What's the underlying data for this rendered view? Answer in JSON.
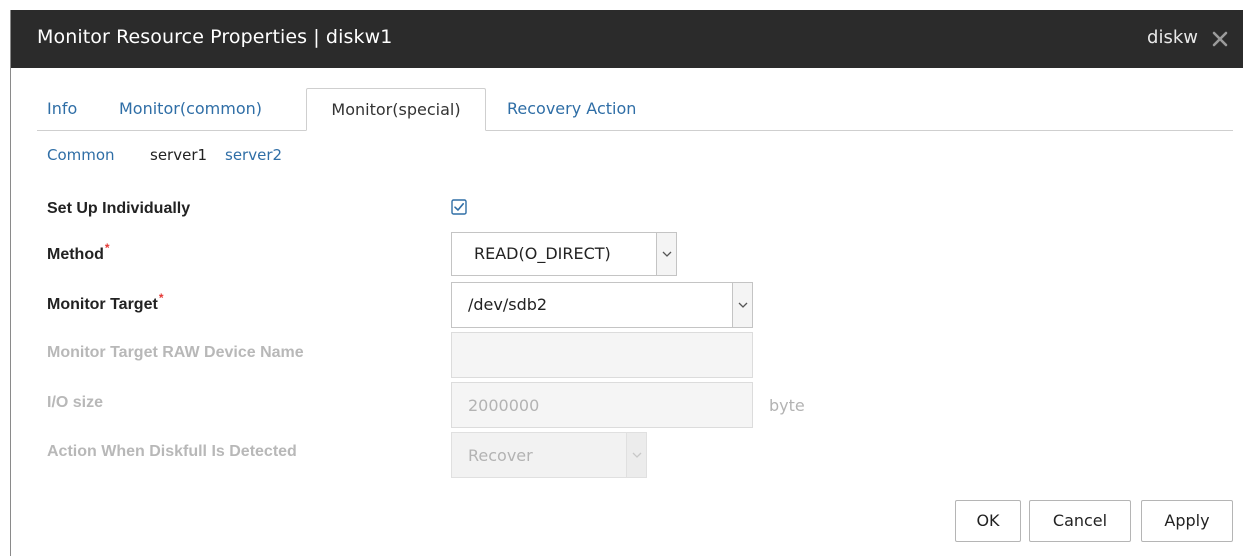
{
  "dialog": {
    "title": "Monitor Resource Properties | diskw1",
    "title_right": "diskw"
  },
  "tabs": [
    {
      "label": "Info",
      "active": false
    },
    {
      "label": "Monitor(common)",
      "active": false
    },
    {
      "label": "Monitor(special)",
      "active": true
    },
    {
      "label": "Recovery Action",
      "active": false
    }
  ],
  "subtabs": [
    {
      "label": "Common",
      "active": false
    },
    {
      "label": "server1",
      "active": true
    },
    {
      "label": "server2",
      "active": false
    }
  ],
  "form": {
    "setup_individually": {
      "label": "Set Up Individually",
      "checked": true
    },
    "method": {
      "label": "Method",
      "required_mark": "*",
      "value": "READ(O_DIRECT)"
    },
    "monitor_target": {
      "label": "Monitor Target",
      "required_mark": "*",
      "value": "/dev/sdb2"
    },
    "raw_device": {
      "label": "Monitor Target RAW Device Name",
      "value": ""
    },
    "io_size": {
      "label": "I/O size",
      "value": "2000000",
      "unit": "byte"
    },
    "diskfull_action": {
      "label": "Action When Diskfull Is Detected",
      "value": "Recover"
    }
  },
  "buttons": {
    "ok": "OK",
    "cancel": "Cancel",
    "apply": "Apply"
  },
  "colors": {
    "titlebar": "#2b2b2b",
    "link": "#2f6ea6",
    "required": "#e53935",
    "checkbox": "#2f6ea6"
  }
}
